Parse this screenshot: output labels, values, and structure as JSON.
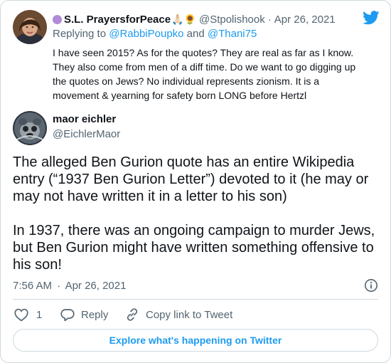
{
  "parent_tweet": {
    "display_name": "S.L. PrayersforPeace",
    "handle": "@Stpolishook",
    "separator": "·",
    "date": "Apr 26, 2021",
    "replying_to_prefix": "Replying to ",
    "replying_to_1": "@RabbiPoupko",
    "replying_to_and": " and ",
    "replying_to_2": "@Thani75",
    "text_lines": [
      "I have seen 2015? As for the quotes? They are real as far as I know.",
      "They also come from men of a diff time. Do we want to go digging up",
      "the quotes on Jews? No individual represents zionism.  It is a",
      "movement & yearning for safety born LONG before Hertzl"
    ]
  },
  "main_tweet": {
    "display_name": "maor eichler",
    "handle": "@EichlerMaor",
    "text_lines": [
      "The alleged Ben Gurion quote has an entire Wikipedia",
      "entry (“1937 Ben Gurion Letter”) devoted to it (he may or",
      "may not have written it in a letter to his son)",
      "",
      "In 1937, there was an ongoing campaign to murder Jews,",
      "but Ben Gurion might have written something offensive to",
      "his son!"
    ],
    "time": "7:56 AM",
    "separator": "·",
    "date": "Apr 26, 2021"
  },
  "actions": {
    "like_count": "1",
    "reply_label": "Reply",
    "copy_link_label": "Copy link to Tweet"
  },
  "explore_button_label": "Explore what's happening on Twitter",
  "colors": {
    "twitter_blue": "#1d9bf0",
    "muted_text": "#536471",
    "border": "#cfd9de"
  }
}
